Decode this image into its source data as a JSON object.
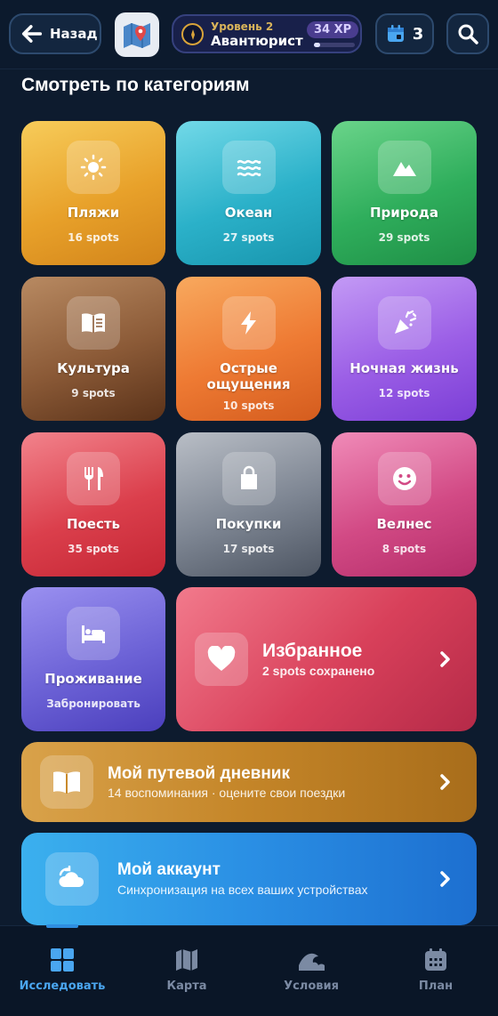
{
  "header": {
    "back_label": "Назад",
    "level_label": "Уровень 2",
    "rank_label": "Авантюрист",
    "xp_label": "34 XP",
    "xp_progress": 0.15,
    "calendar_count": "3"
  },
  "section_title": "Смотреть по категориям",
  "categories": [
    {
      "name": "Пляжи",
      "count": "16 spots",
      "icon": "sun-icon",
      "color": "#e8a12a"
    },
    {
      "name": "Океан",
      "count": "27 spots",
      "icon": "waves-icon",
      "color": "#2bb1c9"
    },
    {
      "name": "Природа",
      "count": "29 spots",
      "icon": "mountain-icon",
      "color": "#2fae5c"
    },
    {
      "name": "Культура",
      "count": "9 spots",
      "icon": "book-icon",
      "color": "#8b5a37"
    },
    {
      "name": "Острые ощущения",
      "count": "10 spots",
      "icon": "bolt-icon",
      "color": "#ee7a33"
    },
    {
      "name": "Ночная жизнь",
      "count": "12 spots",
      "icon": "party-icon",
      "color": "#9b5ee6"
    },
    {
      "name": "Поесть",
      "count": "35 spots",
      "icon": "utensils-icon",
      "color": "#db3f4c"
    },
    {
      "name": "Покупки",
      "count": "17 spots",
      "icon": "shopping-bag-icon",
      "color": "#7d8592"
    },
    {
      "name": "Велнес",
      "count": "8 spots",
      "icon": "smile-icon",
      "color": "#d24a85"
    },
    {
      "name": "Проживание",
      "count": "Забронировать",
      "icon": "bed-icon",
      "color": "#6c62d6"
    }
  ],
  "favorites": {
    "title": "Избранное",
    "subtitle": "2 spots сохранено",
    "icon": "heart-icon",
    "color": "#e0455e"
  },
  "journal": {
    "title": "Мой путевой дневник",
    "subtitle": "14 воспоминания · оцените свои поездки",
    "icon": "book-open-icon",
    "color": "#c98a2c"
  },
  "account": {
    "title": "Мой аккаунт",
    "subtitle": "Синхронизация на всех ваших устройствах",
    "icon": "cloud-sync-icon",
    "color": "#2a8fe4"
  },
  "nav": [
    {
      "label": "Исследовать",
      "icon": "grid-icon",
      "active": true
    },
    {
      "label": "Карта",
      "icon": "map-icon",
      "active": false
    },
    {
      "label": "Условия",
      "icon": "wave-icon",
      "active": false
    },
    {
      "label": "План",
      "icon": "calendar-icon",
      "active": false
    }
  ]
}
